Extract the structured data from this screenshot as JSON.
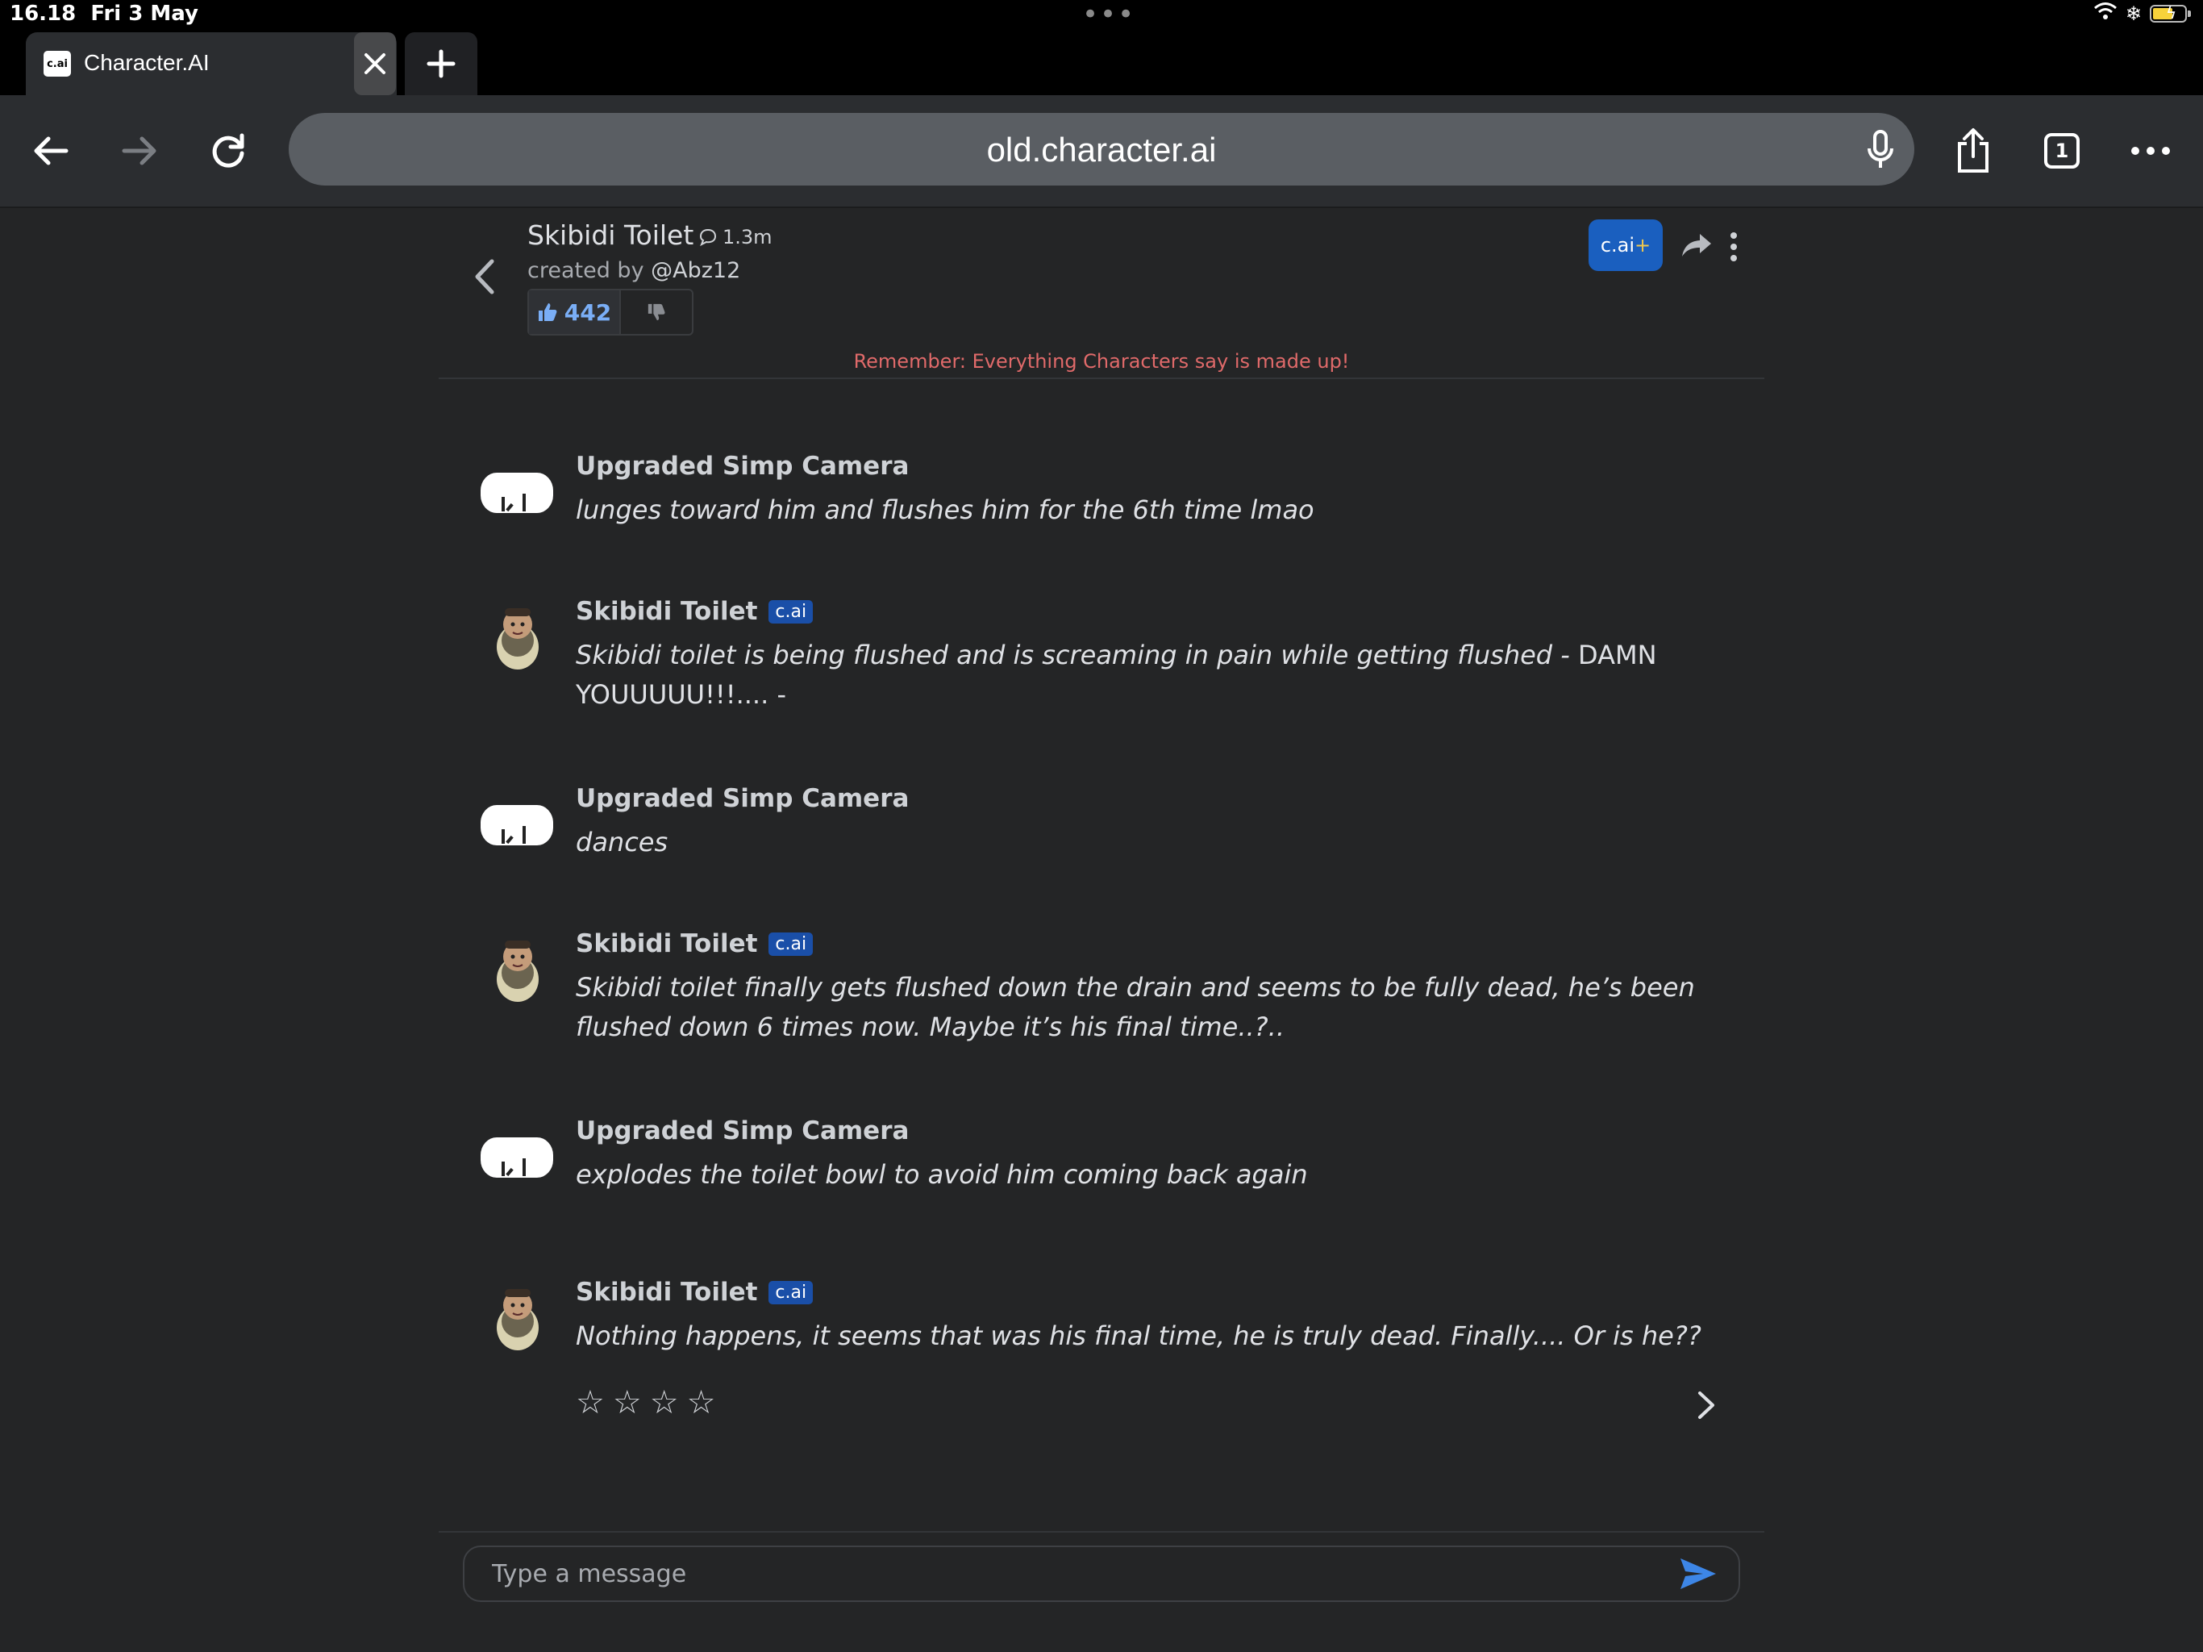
{
  "status_bar": {
    "time": "16.18",
    "date": "Fri 3 May",
    "center_dots": "•••"
  },
  "browser": {
    "tab_title": "Character.AI",
    "tab_favicon_text": "c.ai",
    "url": "old.character.ai",
    "tab_count": "1"
  },
  "chat_header": {
    "character_name": "Skibidi Toilet",
    "chat_count": "1.3m",
    "created_by_label": "created by",
    "creator_handle": "@Abz12",
    "likes": "442",
    "plus_label": "c.ai",
    "plus_symbol": "+",
    "reminder": "Remember: Everything Characters say is made up!"
  },
  "messages": [
    {
      "sender": "Upgraded Simp Camera",
      "type": "user",
      "badge": "",
      "text_italic": "lunges toward him and flushes him for the 6th time lmao",
      "text_normal": ""
    },
    {
      "sender": "Skibidi Toilet",
      "type": "bot",
      "badge": "c.ai",
      "text_italic": "Skibidi toilet is being flushed and is screaming in pain while getting flushed - ",
      "text_normal": "DAMN YOUUUUU!!!.... -"
    },
    {
      "sender": "Upgraded Simp Camera",
      "type": "user",
      "badge": "",
      "text_italic": "dances",
      "text_normal": ""
    },
    {
      "sender": "Skibidi Toilet",
      "type": "bot",
      "badge": "c.ai",
      "text_italic": "Skibidi toilet finally gets flushed down the drain and seems to be fully dead, he’s been flushed down 6 times now. Maybe it’s his final time..?..",
      "text_normal": ""
    },
    {
      "sender": "Upgraded Simp Camera",
      "type": "user",
      "badge": "",
      "text_italic": "explodes the toilet bowl to avoid him coming back again",
      "text_normal": ""
    },
    {
      "sender": "Skibidi Toilet",
      "type": "bot",
      "badge": "c.ai",
      "text_italic": "Nothing happens, it seems that was his final time, he is truly dead. Finally.... Or is he??",
      "text_normal": ""
    }
  ],
  "rating": {
    "stars": [
      "☆",
      "☆",
      "☆",
      "☆"
    ],
    "value": 0,
    "max": 4
  },
  "composer": {
    "placeholder": "Type a message"
  },
  "colors": {
    "background": "#242526",
    "accent": "#1a5fbf",
    "reminder": "#e06a6a",
    "like": "#7aaef6"
  }
}
